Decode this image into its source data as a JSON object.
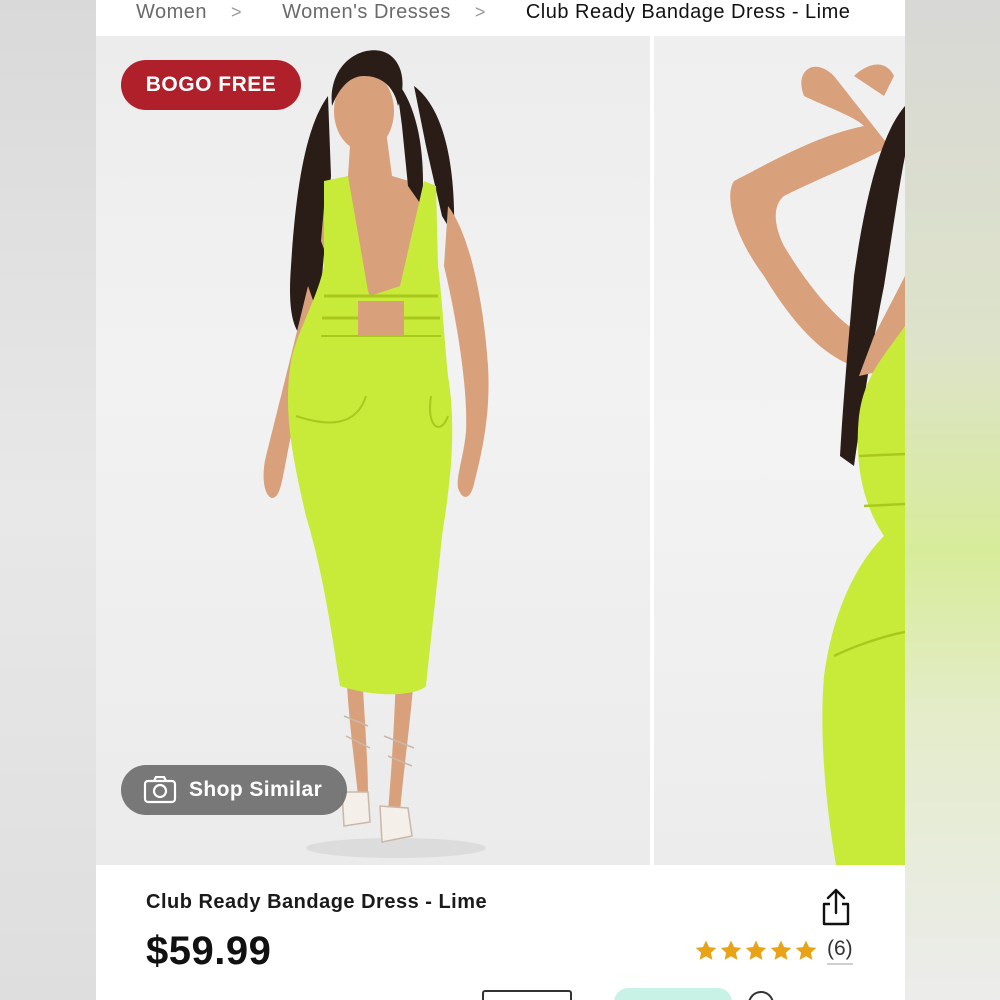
{
  "breadcrumb": {
    "items": [
      "Women",
      "Women's Dresses",
      "Club Ready Bandage Dress - Lime"
    ],
    "separator": ">"
  },
  "gallery": {
    "badge_label": "BOGO FREE",
    "shop_similar_label": "Shop Similar",
    "badge_color": "#b0202a",
    "dress_color": "#c8ea38"
  },
  "product": {
    "title": "Club Ready Bandage Dress - Lime",
    "price": "$59.99",
    "rating_stars": 5,
    "rating_count": "(6)",
    "star_color": "#e8a317"
  },
  "icons": {
    "share": "share-icon",
    "camera": "camera-icon",
    "star": "star-icon"
  }
}
